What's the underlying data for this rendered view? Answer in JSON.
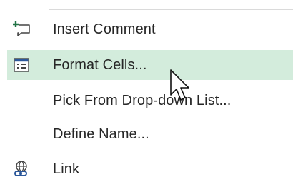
{
  "context_menu": {
    "items": [
      {
        "label": "Insert Comment",
        "access_key": "m",
        "icon": "insert-comment-icon",
        "hovered": false
      },
      {
        "label": "Format Cells...",
        "access_key": "F",
        "icon": "format-cells-icon",
        "hovered": true
      },
      {
        "label": "Pick From Drop-down List...",
        "access_key": "K",
        "icon": "",
        "hovered": false
      },
      {
        "label": "Define Name...",
        "access_key": "a",
        "icon": "",
        "hovered": false
      },
      {
        "label": "Link",
        "access_key": "i",
        "icon": "link-icon",
        "hovered": false
      }
    ]
  },
  "colors": {
    "hover_background": "#d3ecdc",
    "icon_green": "#217346",
    "icon_blue": "#2b579a",
    "text": "#262626"
  }
}
